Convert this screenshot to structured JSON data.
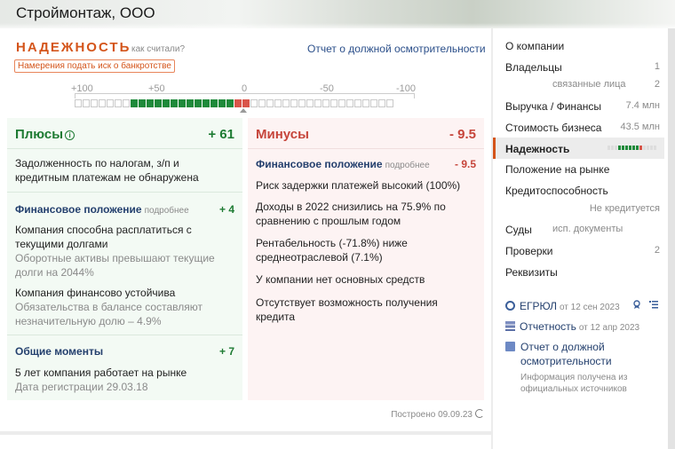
{
  "company": "Строймонтаж, ООО",
  "reliability": {
    "title": "НАДЕЖНОСТЬ",
    "how_link": "как считали?",
    "report_link": "Отчет о должной осмотрительности",
    "bankrupt_badge": "Намерения подать иск о банкротстве",
    "scale_labels": [
      "+100",
      "+50",
      "0",
      "-50",
      "-100"
    ]
  },
  "pros": {
    "title": "Плюсы",
    "value": "+ 61",
    "item1": "Задолженность по налогам, з/п и кредитным платежам не обнаружена",
    "section1": {
      "title": "Финансовое положение",
      "more": "подробнее",
      "value": "+ 4"
    },
    "item2": "Компания способна расплатиться с текущими долгами",
    "item2_sub": "Оборотные активы превышают текущие долги на 2044%",
    "item3": "Компания финансово устойчива",
    "item3_sub": "Обязательства в балансе составляют незначительную долю – 4.9%",
    "section2": {
      "title": "Общие моменты",
      "value": "+ 7"
    },
    "item4": "5 лет компания работает на рынке",
    "item4_sub": "Дата регистрации 29.03.18"
  },
  "cons": {
    "title": "Минусы",
    "value": "- 9.5",
    "section1": {
      "title": "Финансовое положение",
      "more": "подробнее",
      "value": "- 9.5"
    },
    "items": [
      "Риск задержки платежей высокий (100%)",
      "Доходы в 2022 снизились на 75.9% по сравнению с прошлым годом",
      "Рентабельность (-71.8%) ниже среднеотраслевой (7.1%)",
      "У компании нет основных средств",
      "Отсутствует возможность получения кредита"
    ]
  },
  "built": "Построено 09.09.23",
  "nav": {
    "about": "О компании",
    "owners": "Владельцы",
    "owners_count": "1",
    "related": "связанные лица",
    "related_count": "2",
    "revenue": "Выручка / Финансы",
    "revenue_value": "7.4 млн",
    "value": "Стоимость бизнеса",
    "value_amount": "43.5 млн",
    "reliability": "Надежность",
    "market": "Положение на рынке",
    "credit": "Кредитоспособность",
    "credit_status": "Не кредитуется",
    "courts": "Суды",
    "courts_docs": "исп. документы",
    "checks": "Проверки",
    "checks_count": "2",
    "requisites": "Реквизиты"
  },
  "sources": {
    "egrul": "ЕГРЮЛ",
    "egrul_date": "от 12 сен 2023",
    "reporting": "Отчетность",
    "reporting_date": "от 12 апр 2023",
    "report": "Отчет о должной осмотрительности",
    "note": "Информация получена из официальных источников"
  },
  "colors": {
    "accent": "#d4551b",
    "positive": "#1e7b33",
    "negative": "#c6453b",
    "link": "#24406e"
  }
}
